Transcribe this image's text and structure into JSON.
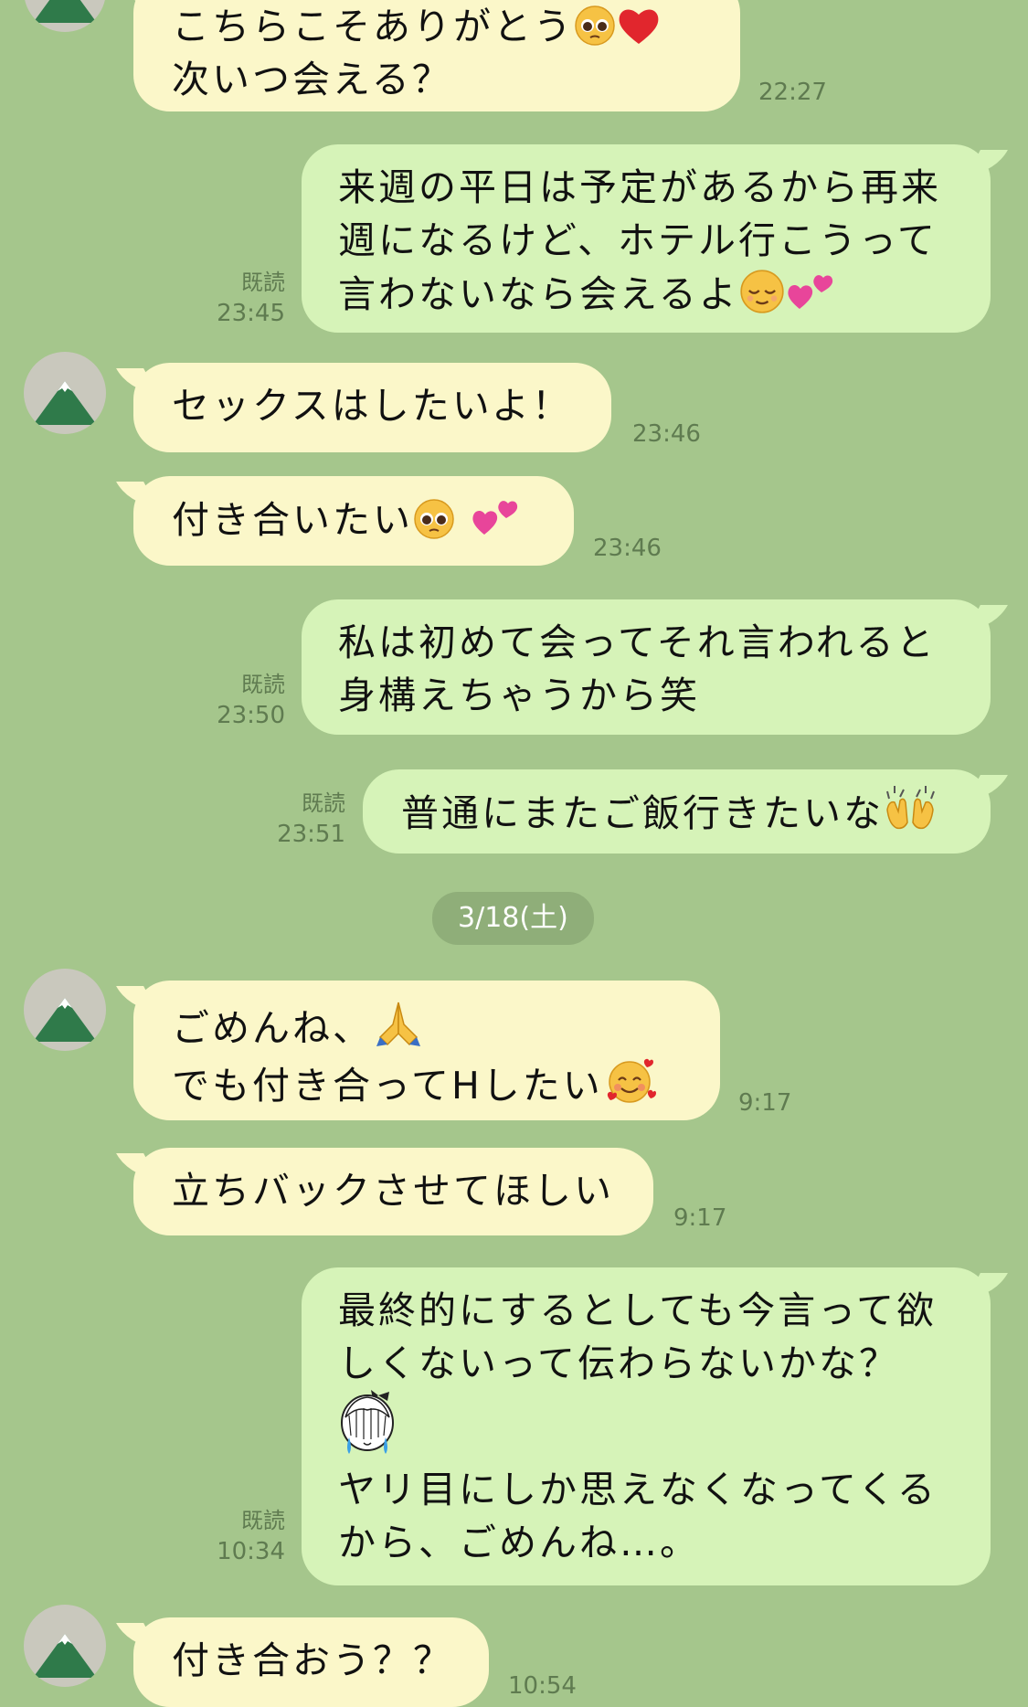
{
  "messages": [
    {
      "id": "m1",
      "side": "in",
      "lines": [
        "こちらこそありがとう",
        "次いつ会える？"
      ],
      "time": "22:27"
    },
    {
      "id": "m2",
      "side": "out",
      "lines": [
        "来週の平日は予定があるから再来",
        "週になるけど、ホテル行こうって",
        "言わないなら会えるよ"
      ],
      "read": "既読",
      "time": "23:45"
    },
    {
      "id": "m3",
      "side": "in",
      "lines": [
        "セックスはしたいよ！"
      ],
      "time": "23:46"
    },
    {
      "id": "m4",
      "side": "in",
      "lines": [
        "付き合いたい"
      ],
      "time": "23:46"
    },
    {
      "id": "m5",
      "side": "out",
      "lines": [
        "私は初めて会ってそれ言われると",
        "身構えちゃうから笑"
      ],
      "read": "既読",
      "time": "23:50"
    },
    {
      "id": "m6",
      "side": "out",
      "lines": [
        "普通にまたご飯行きたいな"
      ],
      "read": "既読",
      "time": "23:51"
    },
    {
      "id": "m7",
      "side": "in",
      "lines": [
        "ごめんね、",
        "でも付き合ってHしたい"
      ],
      "time": "9:17"
    },
    {
      "id": "m8",
      "side": "in",
      "lines": [
        "立ちバックさせてほしい"
      ],
      "time": "9:17"
    },
    {
      "id": "m9",
      "side": "out",
      "lines": [
        "最終的にするとしても今言って欲",
        "しくないって伝わらないかな？",
        "ヤリ目にしか思えなくなってくる",
        "から、ごめんね…。"
      ],
      "read": "既読",
      "time": "10:34"
    },
    {
      "id": "m10",
      "side": "in",
      "lines": [
        "付き合おう？？"
      ],
      "time": "10:54"
    }
  ],
  "date_divider": "3/18(土)",
  "emoji_names": [
    "pleading-face",
    "red-heart",
    "relieved-face",
    "two-hearts",
    "raising-hands",
    "folded-hands",
    "smiling-face-with-hearts",
    "crying-girl-sticker"
  ],
  "colors": {
    "background": "#a5c68c",
    "incoming_bubble": "#fbf7c9",
    "outgoing_bubble": "#d6f3b8",
    "date_pill": "#8fae79"
  }
}
